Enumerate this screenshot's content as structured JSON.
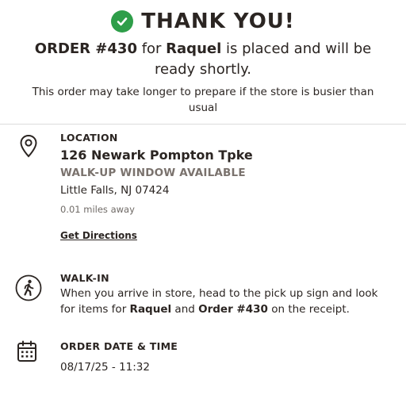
{
  "header": {
    "title": "THANK YOU!",
    "order_prefix": "ORDER #430",
    "order_for": " for ",
    "customer_name": "Raquel",
    "order_suffix": " is placed and will be ready shortly.",
    "note": "This order may take longer to prepare if the store is busier than usual"
  },
  "location": {
    "label": "LOCATION",
    "address": "126 Newark Pompton Tpke",
    "feature": "WALK-UP WINDOW AVAILABLE",
    "city": "Little Falls, NJ 07424",
    "distance": "0.01 miles away",
    "directions_label": "Get Directions"
  },
  "walkin": {
    "label": "WALK-IN",
    "text_1": "When you arrive in store, head to the pick up sign and look for items for ",
    "name": "Raquel",
    "text_2": " and ",
    "order": "Order #430",
    "text_3": " on the receipt."
  },
  "order_time": {
    "label": "ORDER DATE & TIME",
    "value": "08/17/25 - 11:32"
  },
  "icons": {
    "success": "check-circle-icon",
    "location": "map-pin-icon",
    "walkin": "walking-person-icon",
    "calendar": "calendar-icon"
  },
  "colors": {
    "success": "#2e9e49",
    "text": "#2b2522",
    "muted": "#7a726d"
  }
}
